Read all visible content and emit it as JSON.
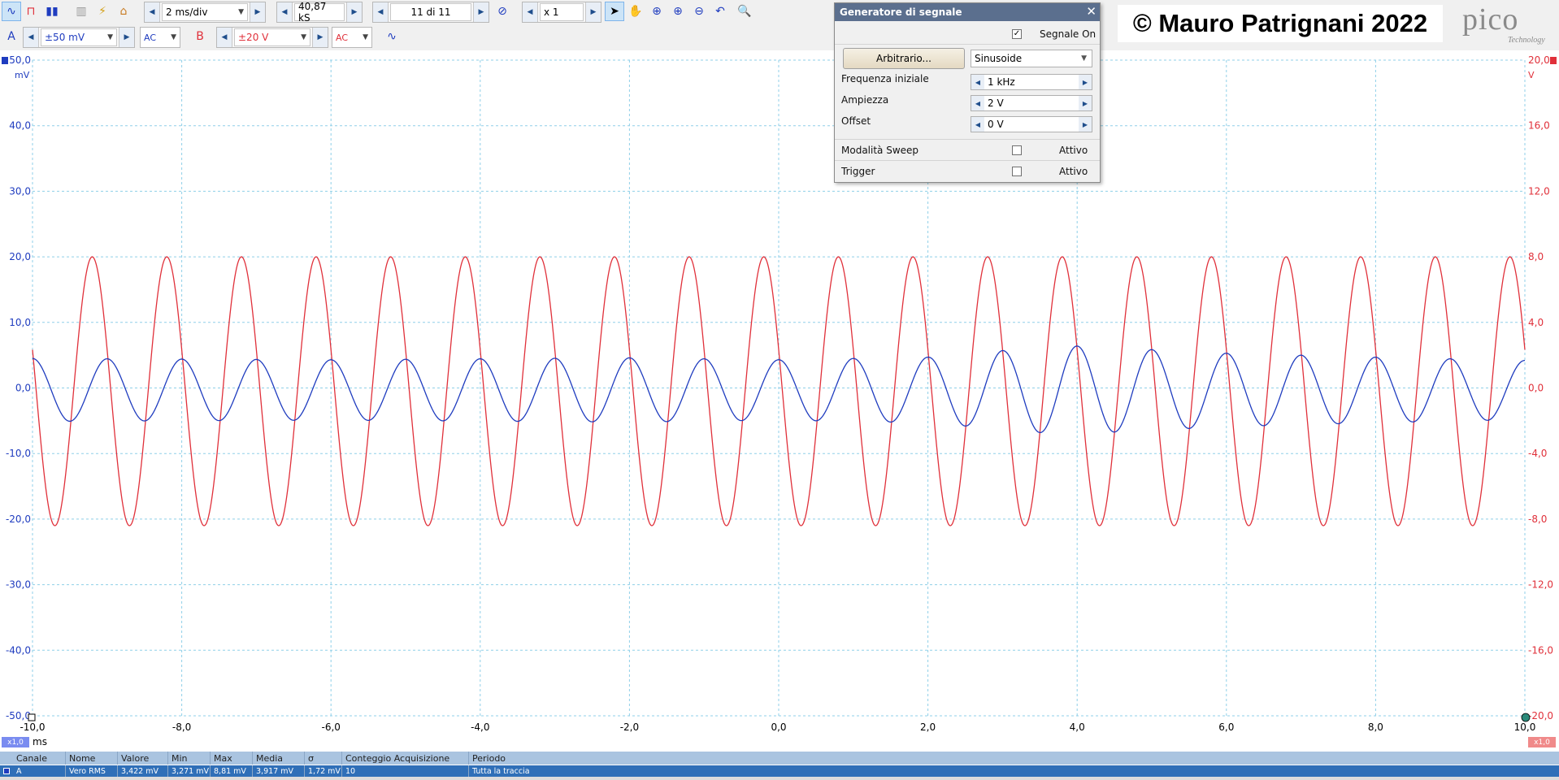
{
  "toolbar": {
    "timebase": "2 ms/div",
    "samples": "40,87 kS",
    "capture": "11 di 11",
    "zoom": "x 1",
    "channel_a": {
      "letter": "A",
      "range": "±50 mV",
      "coupling": "AC",
      "color": "#1f3cbf"
    },
    "channel_b": {
      "letter": "B",
      "range": "±20 V",
      "coupling": "AC",
      "color": "#e0303a"
    }
  },
  "siggen": {
    "title": "Generatore di segnale",
    "signal_on": "Segnale On",
    "arbitrary_button": "Arbitrario...",
    "waveform": "Sinusoide",
    "freq_label": "Frequenza iniziale",
    "freq_value": "1 kHz",
    "amp_label": "Ampiezza",
    "amp_value": "2 V",
    "offset_label": "Offset",
    "offset_value": "0 V",
    "sweep_label": "Modalità Sweep",
    "sweep_active": "Attivo",
    "trigger_label": "Trigger",
    "trigger_active": "Attivo"
  },
  "watermark": "© Mauro Patrignani 2022",
  "logo": {
    "word": "pico",
    "sub": "Technology"
  },
  "axes": {
    "left_unit": "mV",
    "right_unit": "V",
    "x_unit": "ms",
    "scale_left": "x1,0",
    "scale_right": "x1,0"
  },
  "chart_data": {
    "type": "line",
    "x_ticks": [
      "-10,0",
      "-8,0",
      "-6,0",
      "-4,0",
      "-2,0",
      "0,0",
      "2,0",
      "4,0",
      "6,0",
      "8,0",
      "10,0"
    ],
    "y_left_ticks": [
      "50,0",
      "40,0",
      "30,0",
      "20,0",
      "10,0",
      "0,0",
      "-10,0",
      "-20,0",
      "-30,0",
      "-40,0",
      "-50,0"
    ],
    "y_right_ticks": [
      "20,0",
      "16,0",
      "12,0",
      "8,0",
      "4,0",
      "0,0",
      "-4,0",
      "-8,0",
      "-12,0",
      "-16,0",
      "-20,0"
    ],
    "xlim": [
      -10,
      10
    ],
    "ylim_left": [
      -50,
      50
    ],
    "ylim_right": [
      -20,
      20
    ],
    "grid": true,
    "series": [
      {
        "channel": "A",
        "axis": "left",
        "unit": "mV",
        "color": "#1f3cbf",
        "frequency_khz": 1.0,
        "phase_ms": -10.0,
        "offset": -0.3,
        "amplitude_envelope": [
          [
            -10,
            4.8
          ],
          [
            -6,
            4.6
          ],
          [
            -2,
            4.9
          ],
          [
            0,
            4.6
          ],
          [
            2,
            5.0
          ],
          [
            3.8,
            6.8
          ],
          [
            6,
            5.6
          ],
          [
            8,
            5.0
          ],
          [
            10,
            4.5
          ]
        ]
      },
      {
        "channel": "B",
        "axis": "right",
        "unit": "V",
        "color": "#e0303a",
        "frequency_khz": 1.0,
        "phase_ms": -10.2,
        "offset": -0.2,
        "amplitude_envelope": [
          [
            -10,
            8.2
          ],
          [
            10,
            8.2
          ]
        ]
      }
    ]
  },
  "measurements": {
    "headers": [
      "Canale",
      "Nome",
      "Valore",
      "Min",
      "Max",
      "Media",
      "σ",
      "Conteggio Acquisizione",
      "Periodo"
    ],
    "rows": [
      [
        "A",
        "Vero RMS",
        "3,422 mV",
        "3,271 mV",
        "8,81 mV",
        "3,917 mV",
        "1,72 mV",
        "10",
        "Tutta la traccia"
      ]
    ]
  }
}
